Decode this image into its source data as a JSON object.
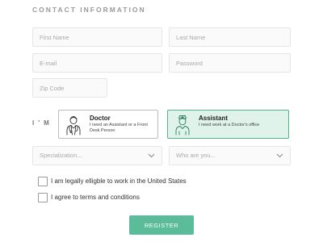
{
  "form": {
    "title": "CONTACT INFORMATION",
    "first_name_placeholder": "First Name",
    "last_name_placeholder": "Last Name",
    "email_placeholder": "E-mail",
    "password_placeholder": "Password",
    "zip_placeholder": "Zip Code"
  },
  "role": {
    "label": "I'M A",
    "options": [
      {
        "name": "Doctor",
        "description": "I need an Assistant or a Front Desk Person",
        "selected": false,
        "icon": "doctor-icon"
      },
      {
        "name": "Assistant",
        "description": "I need work at a Doctor's office",
        "selected": true,
        "icon": "nurse-icon"
      }
    ]
  },
  "selects": {
    "specialization": "Specialization...",
    "who_are_you": "Who are you..."
  },
  "checkboxes": {
    "legal": "I am legally elligble to work in the United States",
    "terms": "I agree to terms and conditions"
  },
  "register_label": "REGISTER",
  "colors": {
    "accent": "#5bbc99",
    "selected_bg": "#dff3ea",
    "selected_border": "#56b18f",
    "field_bg": "#fafafa"
  }
}
